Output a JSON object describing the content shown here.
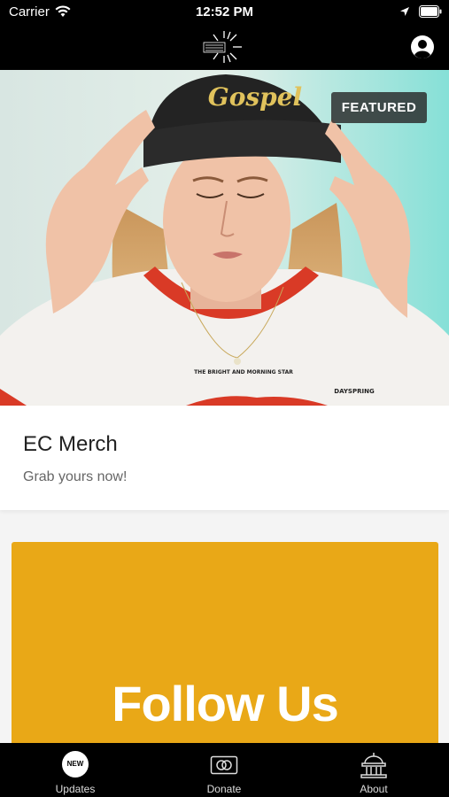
{
  "status_bar": {
    "carrier": "Carrier",
    "time": "12:52 PM"
  },
  "nav": {
    "logo_icon": "sun-logo-icon",
    "profile_icon": "profile-icon"
  },
  "hero": {
    "badge": "FEATURED",
    "beanie_text": "Gospel",
    "shirt_text": "THE BRIGHT AND MORNING STAR",
    "brand_text": "DAYSPRING"
  },
  "card": {
    "title": "EC Merch",
    "subtitle": "Grab yours now!"
  },
  "follow": {
    "text": "Follow Us",
    "color": "#E9A817"
  },
  "tabs": [
    {
      "label": "Updates",
      "icon": "new-badge-icon",
      "badge": "NEW"
    },
    {
      "label": "Donate",
      "icon": "card-icon"
    },
    {
      "label": "About",
      "icon": "building-icon"
    }
  ]
}
